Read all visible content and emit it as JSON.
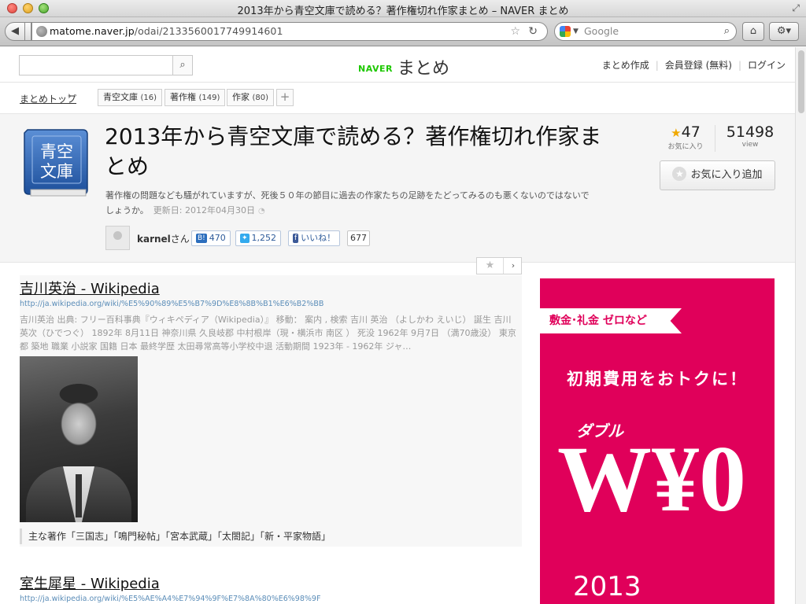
{
  "window": {
    "title": "2013年から青空文庫で読める？著作権切れ作家まとめ – NAVER まとめ"
  },
  "toolbar": {
    "url_host": "matome.naver.jp",
    "url_path": "/odai/2133560017749914601",
    "search_placeholder": "Google"
  },
  "header": {
    "logo_naver": "NAVER",
    "logo_text": "まとめ",
    "nav": [
      "まとめ作成",
      "会員登録 (無料)",
      "ログイン"
    ]
  },
  "breadcrumb": {
    "home": "まとめトップ",
    "tags": [
      {
        "label": "青空文庫",
        "count": "(16)"
      },
      {
        "label": "著作権",
        "count": "(149)"
      },
      {
        "label": "作家",
        "count": "(80)"
      }
    ],
    "add": "+"
  },
  "matome": {
    "icon_text": "青空\n文庫",
    "title": "2013年から青空文庫で読める？著作権切れ作家まとめ",
    "description": "著作権の問題なども騒がれていますが、死後５０年の節目に過去の作家たちの足跡をたどってみるのも悪くないのではないでしょうか。",
    "updated": "更新日: 2012年04月30日",
    "favorites": "47",
    "favorites_label": "お気に入り",
    "views": "51498",
    "views_label": "view",
    "fav_button": "お気に入り追加",
    "author": "karnel",
    "author_suffix": "さん",
    "share": {
      "hatena": "470",
      "twitter": "1,252",
      "facebook_label": "いいね！",
      "facebook_count": "677"
    }
  },
  "items": [
    {
      "title": "吉川英治 - Wikipedia",
      "url": "http://ja.wikipedia.org/wiki/%E5%90%89%E5%B7%9D%E8%8B%B1%E6%B2%BB",
      "snippet": "吉川英治 出典: フリー百科事典『ウィキペディア（Wikipedia）』 移動： 案内 , 検索 吉川 英治 （よしかわ えいじ） 誕生 吉川英次（ひでつぐ） 1892年 8月11日 神奈川県 久良岐郡 中村根岸（現・横浜市 南区 ） 死没 1962年 9月7日 （満70歳没） 東京都 築地 職業 小説家 国籍 日本 最終学歴 太田尋常高等小学校中退 活動期間 1923年 - 1962年 ジャ…",
      "quote": "主な著作「三国志」「鳴門秘帖」「宮本武蔵」「太閤記」「新・平家物語」"
    },
    {
      "title": "室生犀星 - Wikipedia",
      "url": "http://ja.wikipedia.org/wiki/%E5%AE%A4%E7%94%9F%E7%8A%80%E6%98%9F"
    }
  ],
  "ad": {
    "ribbon": "敷金･礼金 ゼロなど",
    "line1": "初期費用をおトクに！",
    "line2": "ダブル",
    "big": "W¥0",
    "year": "2013"
  },
  "colors": {
    "ad_bg": "#e0005a",
    "naver_green": "#1ec800",
    "link_url": "#5b8db8"
  }
}
